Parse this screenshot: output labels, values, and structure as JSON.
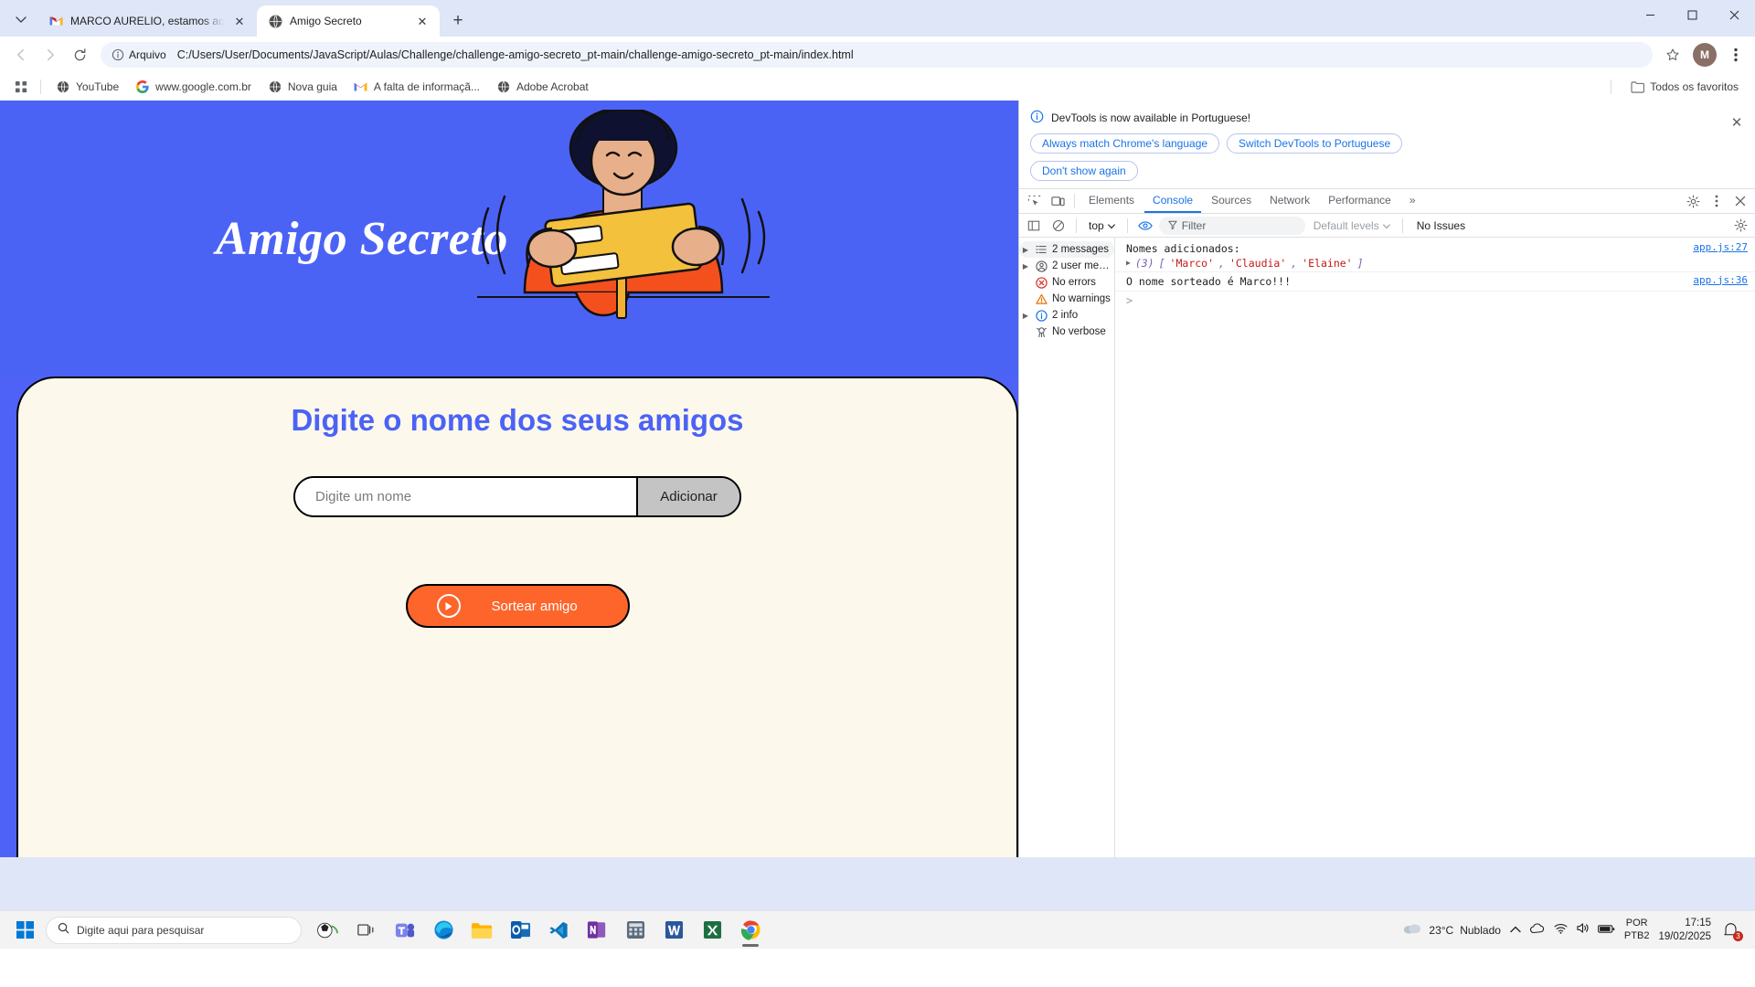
{
  "browser": {
    "tabs": [
      {
        "title": "MARCO AURELIO, estamos aqui",
        "favicon": "gmail-icon",
        "active": false
      },
      {
        "title": "Amigo Secreto",
        "favicon": "globe-icon",
        "active": true
      }
    ],
    "new_tab_label": "+",
    "omnibox": {
      "chip_label": "Arquivo",
      "url": "C:/Users/User/Documents/JavaScript/Aulas/Challenge/challenge-amigo-secreto_pt-main/challenge-amigo-secreto_pt-main/index.html"
    },
    "avatar_letter": "M",
    "bookmarks": [
      {
        "label": "YouTube",
        "icon": "globe-icon"
      },
      {
        "label": "www.google.com.br",
        "icon": "google-icon"
      },
      {
        "label": "Nova guia",
        "icon": "globe-icon"
      },
      {
        "label": "A falta de informaçã...",
        "icon": "gmail-icon"
      },
      {
        "label": "Adobe Acrobat",
        "icon": "globe-icon"
      }
    ],
    "all_bookmarks_label": "Todos os favoritos",
    "window_controls": {
      "minimize": "—",
      "maximize": "▢",
      "close": "✕"
    }
  },
  "page": {
    "hero_title": "Amigo Secreto",
    "card_title": "Digite o nome dos seus amigos",
    "input_placeholder": "Digite um nome",
    "input_value": "",
    "add_button": "Adicionar",
    "draw_button": "Sortear amigo"
  },
  "devtools": {
    "notice": {
      "text": "DevTools is now available in Portuguese!",
      "buttons": [
        "Always match Chrome's language",
        "Switch DevTools to Portuguese",
        "Don't show again"
      ],
      "close": "✕"
    },
    "tabs": [
      {
        "label": "Elements",
        "active": false
      },
      {
        "label": "Console",
        "active": true
      },
      {
        "label": "Sources",
        "active": false
      },
      {
        "label": "Network",
        "active": false
      },
      {
        "label": "Performance",
        "active": false
      }
    ],
    "more_tabs": "»",
    "toolbar": {
      "context": "top",
      "filter_placeholder": "Filter",
      "levels": "Default levels",
      "issues": "No Issues"
    },
    "sidebar": [
      {
        "label": "2 messages",
        "icon": "list-icon",
        "expandable": true,
        "selected": true
      },
      {
        "label": "2 user mes...",
        "icon": "user-icon",
        "expandable": true,
        "selected": false
      },
      {
        "label": "No errors",
        "icon": "error-icon",
        "expandable": false,
        "selected": false
      },
      {
        "label": "No warnings",
        "icon": "warning-icon",
        "expandable": false,
        "selected": false
      },
      {
        "label": "2 info",
        "icon": "info-icon",
        "expandable": true,
        "selected": false
      },
      {
        "label": "No verbose",
        "icon": "verbose-icon",
        "expandable": false,
        "selected": false
      }
    ],
    "messages": [
      {
        "line1": "Nomes adicionados:",
        "array_count": "(3)",
        "array_items": [
          "'Marco'",
          "'Claudia'",
          "'Elaine'"
        ],
        "source": "app.js:27"
      },
      {
        "line1": "O nome sorteado é Marco!!!",
        "source": "app.js:36"
      }
    ],
    "prompt": ">"
  },
  "taskbar": {
    "search_placeholder": "Digite aqui para pesquisar",
    "weather": {
      "temp": "23°C",
      "condition": "Nublado"
    },
    "language": {
      "line1": "POR",
      "line2": "PTB2"
    },
    "clock": {
      "time": "17:15",
      "date": "19/02/2025"
    },
    "notification_count": "3"
  },
  "colors": {
    "hero_blue": "#4b63f5",
    "card_cream": "#fdf8ec",
    "accent_orange": "#fe652b",
    "devtools_blue": "#1a73e8"
  }
}
